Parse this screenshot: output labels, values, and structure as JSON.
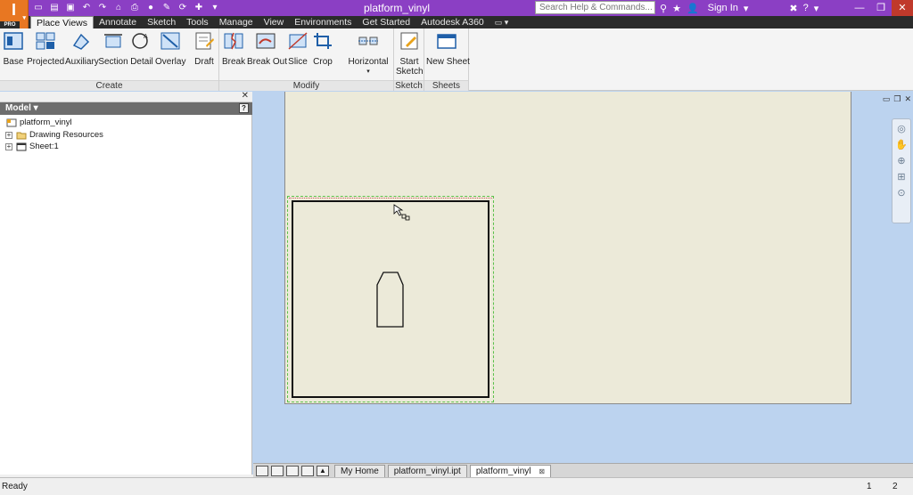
{
  "app": {
    "logo_letter": "I",
    "edition": "PRO",
    "title": "platform_vinyl"
  },
  "titlebar": {
    "search_placeholder": "Search Help & Commands...",
    "sign_in": "Sign In"
  },
  "ribbon_tabs": [
    "Place Views",
    "Annotate",
    "Sketch",
    "Tools",
    "Manage",
    "View",
    "Environments",
    "Get Started",
    "Autodesk A360"
  ],
  "ribbon": {
    "create": {
      "title": "Create",
      "buttons": [
        "Base",
        "Projected",
        "Auxiliary",
        "Section",
        "Detail",
        "Overlay",
        "Draft"
      ]
    },
    "modify": {
      "title": "Modify",
      "buttons": [
        "Break",
        "Break Out",
        "Slice",
        "Crop",
        "Horizontal"
      ]
    },
    "sketch": {
      "title": "Sketch",
      "button_line1": "Start",
      "button_line2": "Sketch"
    },
    "sheets": {
      "title": "Sheets",
      "button": "New Sheet"
    }
  },
  "browser": {
    "header": "Model",
    "items": [
      "platform_vinyl",
      "Drawing Resources",
      "Sheet:1"
    ]
  },
  "doc_tabs": [
    "My Home",
    "platform_vinyl.ipt",
    "platform_vinyl"
  ],
  "status": {
    "text": "Ready",
    "num1": "1",
    "num2": "2"
  },
  "colors": {
    "titlebar": "#8b3fc4",
    "sheet": "#ecead9",
    "background": "#bcd3ef",
    "selection": "#5cc24a"
  }
}
